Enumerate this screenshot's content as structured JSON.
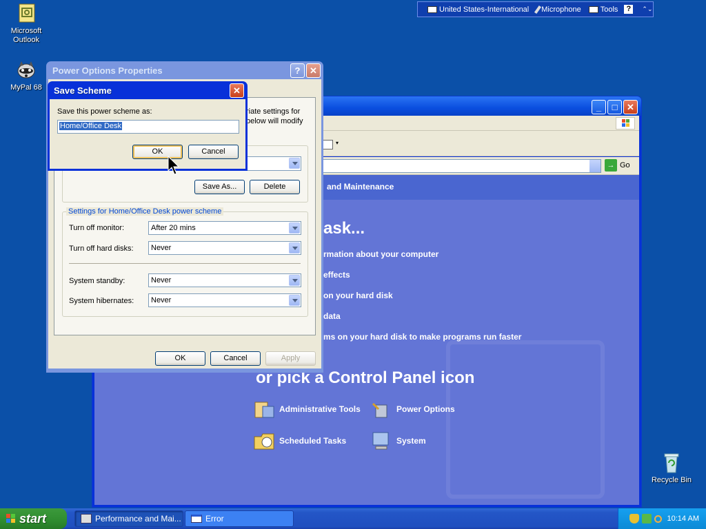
{
  "desktop": {
    "icons": [
      {
        "label": "Microsoft Outlook"
      },
      {
        "label": "MyPal 68"
      },
      {
        "label": "Recycle Bin"
      }
    ]
  },
  "langbar": {
    "language": "United States-International",
    "microphone": "Microphone",
    "tools": "Tools",
    "help": "?"
  },
  "cp_window": {
    "go_label": "Go",
    "crumb": "and Maintenance",
    "heading": "ask...",
    "tasks": [
      "rmation about your computer",
      "effects",
      "on your hard disk",
      "data",
      "ms on your hard disk to make programs run faster"
    ],
    "pick_heading": "or pick a Control Panel icon",
    "icons": [
      {
        "label": "Administrative Tools"
      },
      {
        "label": "Power Options"
      },
      {
        "label": "Scheduled Tasks"
      },
      {
        "label": "System"
      }
    ]
  },
  "power_dialog": {
    "title": "Power Options Properties",
    "desc_line1": "riate settings for",
    "desc_line2": "below will modify",
    "save_as": "Save As...",
    "delete": "Delete",
    "group_title": "Settings for Home/Office Desk power scheme",
    "rows": [
      {
        "label": "Turn off monitor:",
        "value": "After 20 mins"
      },
      {
        "label": "Turn off hard disks:",
        "value": "Never"
      },
      {
        "label": "System standby:",
        "value": "Never"
      },
      {
        "label": "System hibernates:",
        "value": "Never"
      }
    ],
    "ok": "OK",
    "cancel": "Cancel",
    "apply": "Apply"
  },
  "save_dialog": {
    "title": "Save Scheme",
    "prompt": "Save this power scheme as:",
    "input_value": "Home/Office Desk",
    "ok": "OK",
    "cancel": "Cancel"
  },
  "taskbar": {
    "start": "start",
    "items": [
      {
        "label": "Performance and Mai..."
      },
      {
        "label": "Error"
      }
    ],
    "clock": "10:14 AM"
  }
}
